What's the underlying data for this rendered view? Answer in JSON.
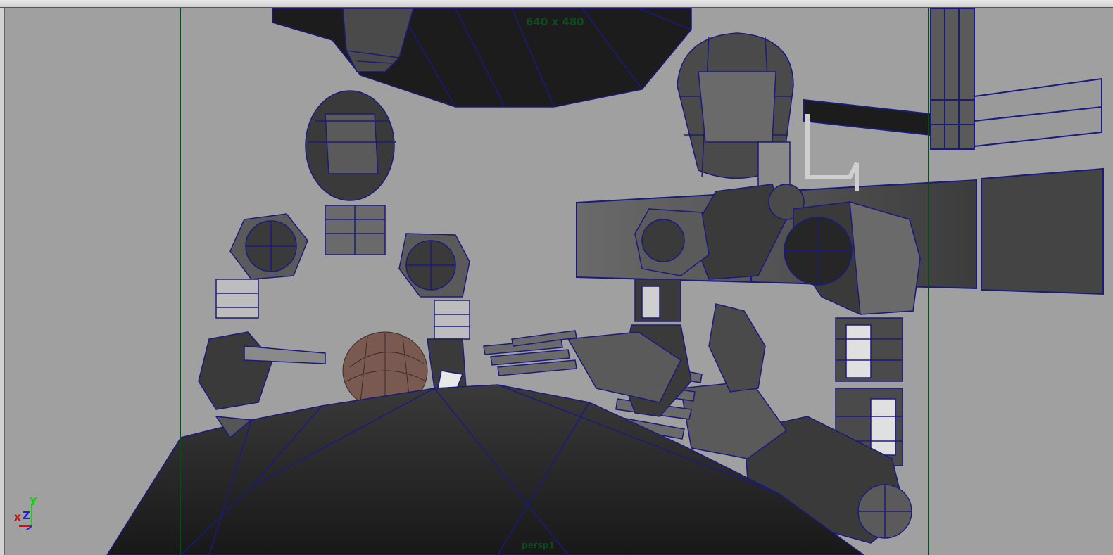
{
  "viewport": {
    "resolution_gate_label": "640 x 480",
    "camera_name_label": "persp1",
    "axes": {
      "x": "x",
      "y": "Y",
      "z": "Z"
    }
  },
  "colors": {
    "viewport_background": "#a0a0a0",
    "wireframe": "#1a1a80",
    "resolution_gate": "#0a4a1a",
    "shaded_dark": "#262626",
    "shaded_mid": "#5a5a5a",
    "shaded_light": "#cfcfcf"
  }
}
